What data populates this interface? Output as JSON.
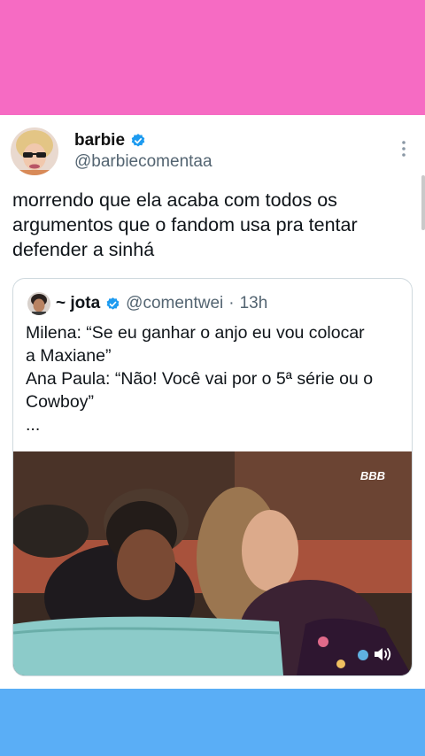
{
  "colors": {
    "top_band": "#f66bc3",
    "bottom_band": "#5aaef6",
    "verified": "#1d9bf0",
    "muted_text": "#536471"
  },
  "tweet": {
    "display_name": "barbie",
    "handle": "@barbiecomentaa",
    "verified_icon": "verified-badge-icon",
    "menu_icon": "more-vertical-icon",
    "lines": [
      "morrendo que ela acaba com todos os",
      "argumentos que o fandom usa pra tentar",
      "defender a sinhá"
    ]
  },
  "quote": {
    "display_name": "~ jota",
    "handle": "@comentwei",
    "separator": "·",
    "time": "13h",
    "lines": [
      "Milena: “Se eu ganhar o anjo eu vou colocar",
      "a Maxiane”",
      "Ana Paula: “Não! Você vai por o 5ª série ou o",
      "Cowboy”",
      "..."
    ],
    "media": {
      "watermark": "BBB",
      "sound_icon": "volume-icon"
    }
  }
}
